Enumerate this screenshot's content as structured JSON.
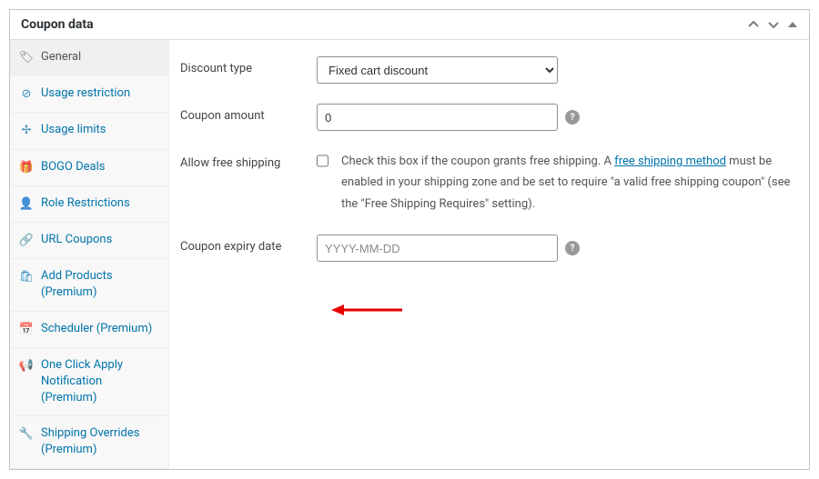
{
  "header": {
    "title": "Coupon data"
  },
  "sidebar": {
    "items": [
      {
        "icon": "🏷",
        "label": "General"
      },
      {
        "icon": "⊘",
        "label": "Usage restriction"
      },
      {
        "icon": "✢",
        "label": "Usage limits"
      },
      {
        "icon": "🎁",
        "label": "BOGO Deals"
      },
      {
        "icon": "👤",
        "label": "Role Restrictions"
      },
      {
        "icon": "🔗",
        "label": "URL Coupons"
      },
      {
        "icon": "🛍",
        "label": "Add Products (Premium)"
      },
      {
        "icon": "📅",
        "label": "Scheduler (Premium)"
      },
      {
        "icon": "📢",
        "label": "One Click Apply Notification (Premium)"
      },
      {
        "icon": "🔧",
        "label": "Shipping Overrides (Premium)"
      }
    ]
  },
  "form": {
    "discount_type": {
      "label": "Discount type",
      "value": "Fixed cart discount"
    },
    "coupon_amount": {
      "label": "Coupon amount",
      "value": "0"
    },
    "free_shipping": {
      "label": "Allow free shipping",
      "desc_prefix": "Check this box if the coupon grants free shipping. A ",
      "link_text": "free shipping method",
      "desc_suffix": " must be enabled in your shipping zone and be set to require \"a valid free shipping coupon\" (see the \"Free Shipping Requires\" setting)."
    },
    "expiry": {
      "label": "Coupon expiry date",
      "placeholder": "YYYY-MM-DD"
    }
  }
}
